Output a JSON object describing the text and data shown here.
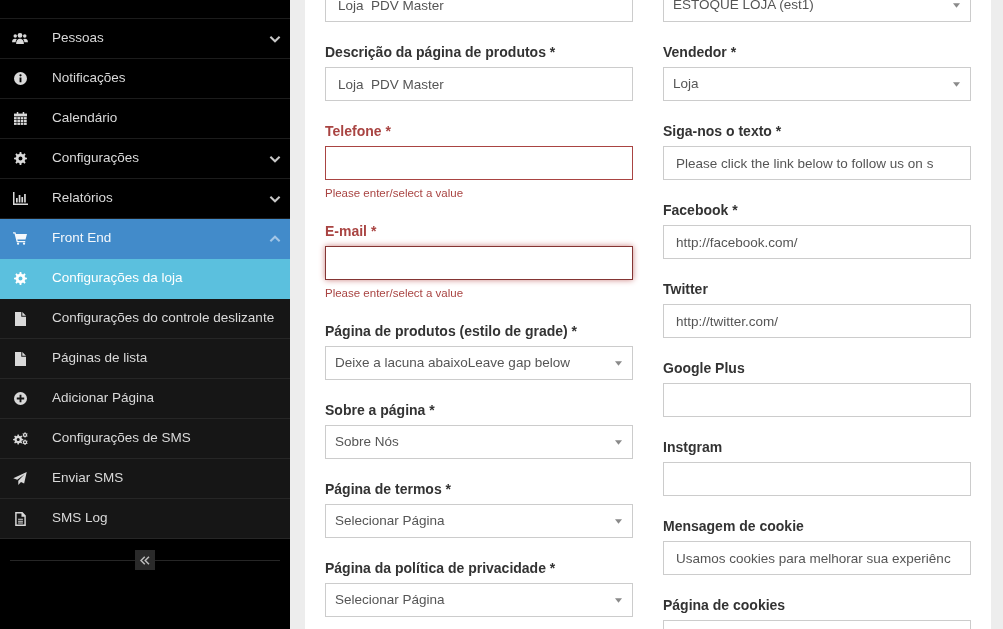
{
  "sidebar": {
    "items": [
      {
        "label": "Pessoas",
        "submenu": true,
        "expanded": false
      },
      {
        "label": "Notificações",
        "submenu": false,
        "expanded": false
      },
      {
        "label": "Calendário",
        "submenu": false,
        "expanded": false
      },
      {
        "label": "Configurações",
        "submenu": true,
        "expanded": false
      },
      {
        "label": "Relatórios",
        "submenu": true,
        "expanded": false
      },
      {
        "label": "Front End",
        "submenu": true,
        "expanded": true,
        "children": [
          {
            "label": "Configurações da loja",
            "selected": true
          },
          {
            "label": "Configurações do controle deslizante",
            "selected": false
          },
          {
            "label": "Páginas de lista",
            "selected": false
          },
          {
            "label": "Adicionar Página",
            "selected": false
          },
          {
            "label": "Configurações de SMS",
            "selected": false
          },
          {
            "label": "Enviar SMS",
            "selected": false
          },
          {
            "label": "SMS Log",
            "selected": false
          }
        ]
      }
    ]
  },
  "form": {
    "columns": [
      {
        "fields": [
          {
            "kind": "input",
            "value": "Loja  PDV Master",
            "error": false,
            "focused": false
          },
          {
            "label": "Descrição da página de produtos *",
            "kind": "input",
            "value": "Loja  PDV Master",
            "error": false,
            "focused": false
          },
          {
            "label": "Telefone *",
            "kind": "input",
            "error": true,
            "focused": false,
            "help": "Please enter/select a value"
          },
          {
            "label": "E-mail *",
            "kind": "input",
            "error": true,
            "focused": true,
            "help": "Please enter/select a value"
          },
          {
            "label": "Página de produtos (estilo de grade) *",
            "kind": "select",
            "value": "Deixe a lacuna abaixoLeave gap below",
            "error": false,
            "focused": false
          },
          {
            "label": "Sobre a página *",
            "kind": "select",
            "value": "Sobre Nós",
            "error": false,
            "focused": false
          },
          {
            "label": "Página de termos *",
            "kind": "select",
            "value": "Selecionar Página",
            "error": false,
            "focused": false
          },
          {
            "label": "Página da política de privacidade *",
            "kind": "select",
            "value": "Selecionar Página",
            "error": false,
            "focused": false
          }
        ]
      },
      {
        "fields": [
          {
            "kind": "select",
            "value": "ESTOQUE LOJA (est1)",
            "error": false,
            "focused": false
          },
          {
            "label": "Vendedor *",
            "kind": "select",
            "value": "Loja",
            "error": false,
            "focused": false
          },
          {
            "label": "Siga-nos o texto *",
            "kind": "input",
            "value": "Please click the link below to follow us on s",
            "error": false,
            "focused": false
          },
          {
            "label": "Facebook *",
            "kind": "input",
            "value": "http://facebook.com/",
            "error": false,
            "focused": false
          },
          {
            "label": "Twitter",
            "kind": "input",
            "value": "http://twitter.com/",
            "error": false,
            "focused": false
          },
          {
            "label": "Google Plus",
            "kind": "input",
            "error": false,
            "focused": false
          },
          {
            "label": "Instgram",
            "kind": "input",
            "error": false,
            "focused": false
          },
          {
            "label": "Mensagem de cookie",
            "kind": "input",
            "value": "Usamos cookies para melhorar sua experiênc",
            "error": false,
            "focused": false
          },
          {
            "label": "Página de cookies",
            "kind": "input",
            "error": false,
            "focused": false
          }
        ]
      }
    ]
  }
}
